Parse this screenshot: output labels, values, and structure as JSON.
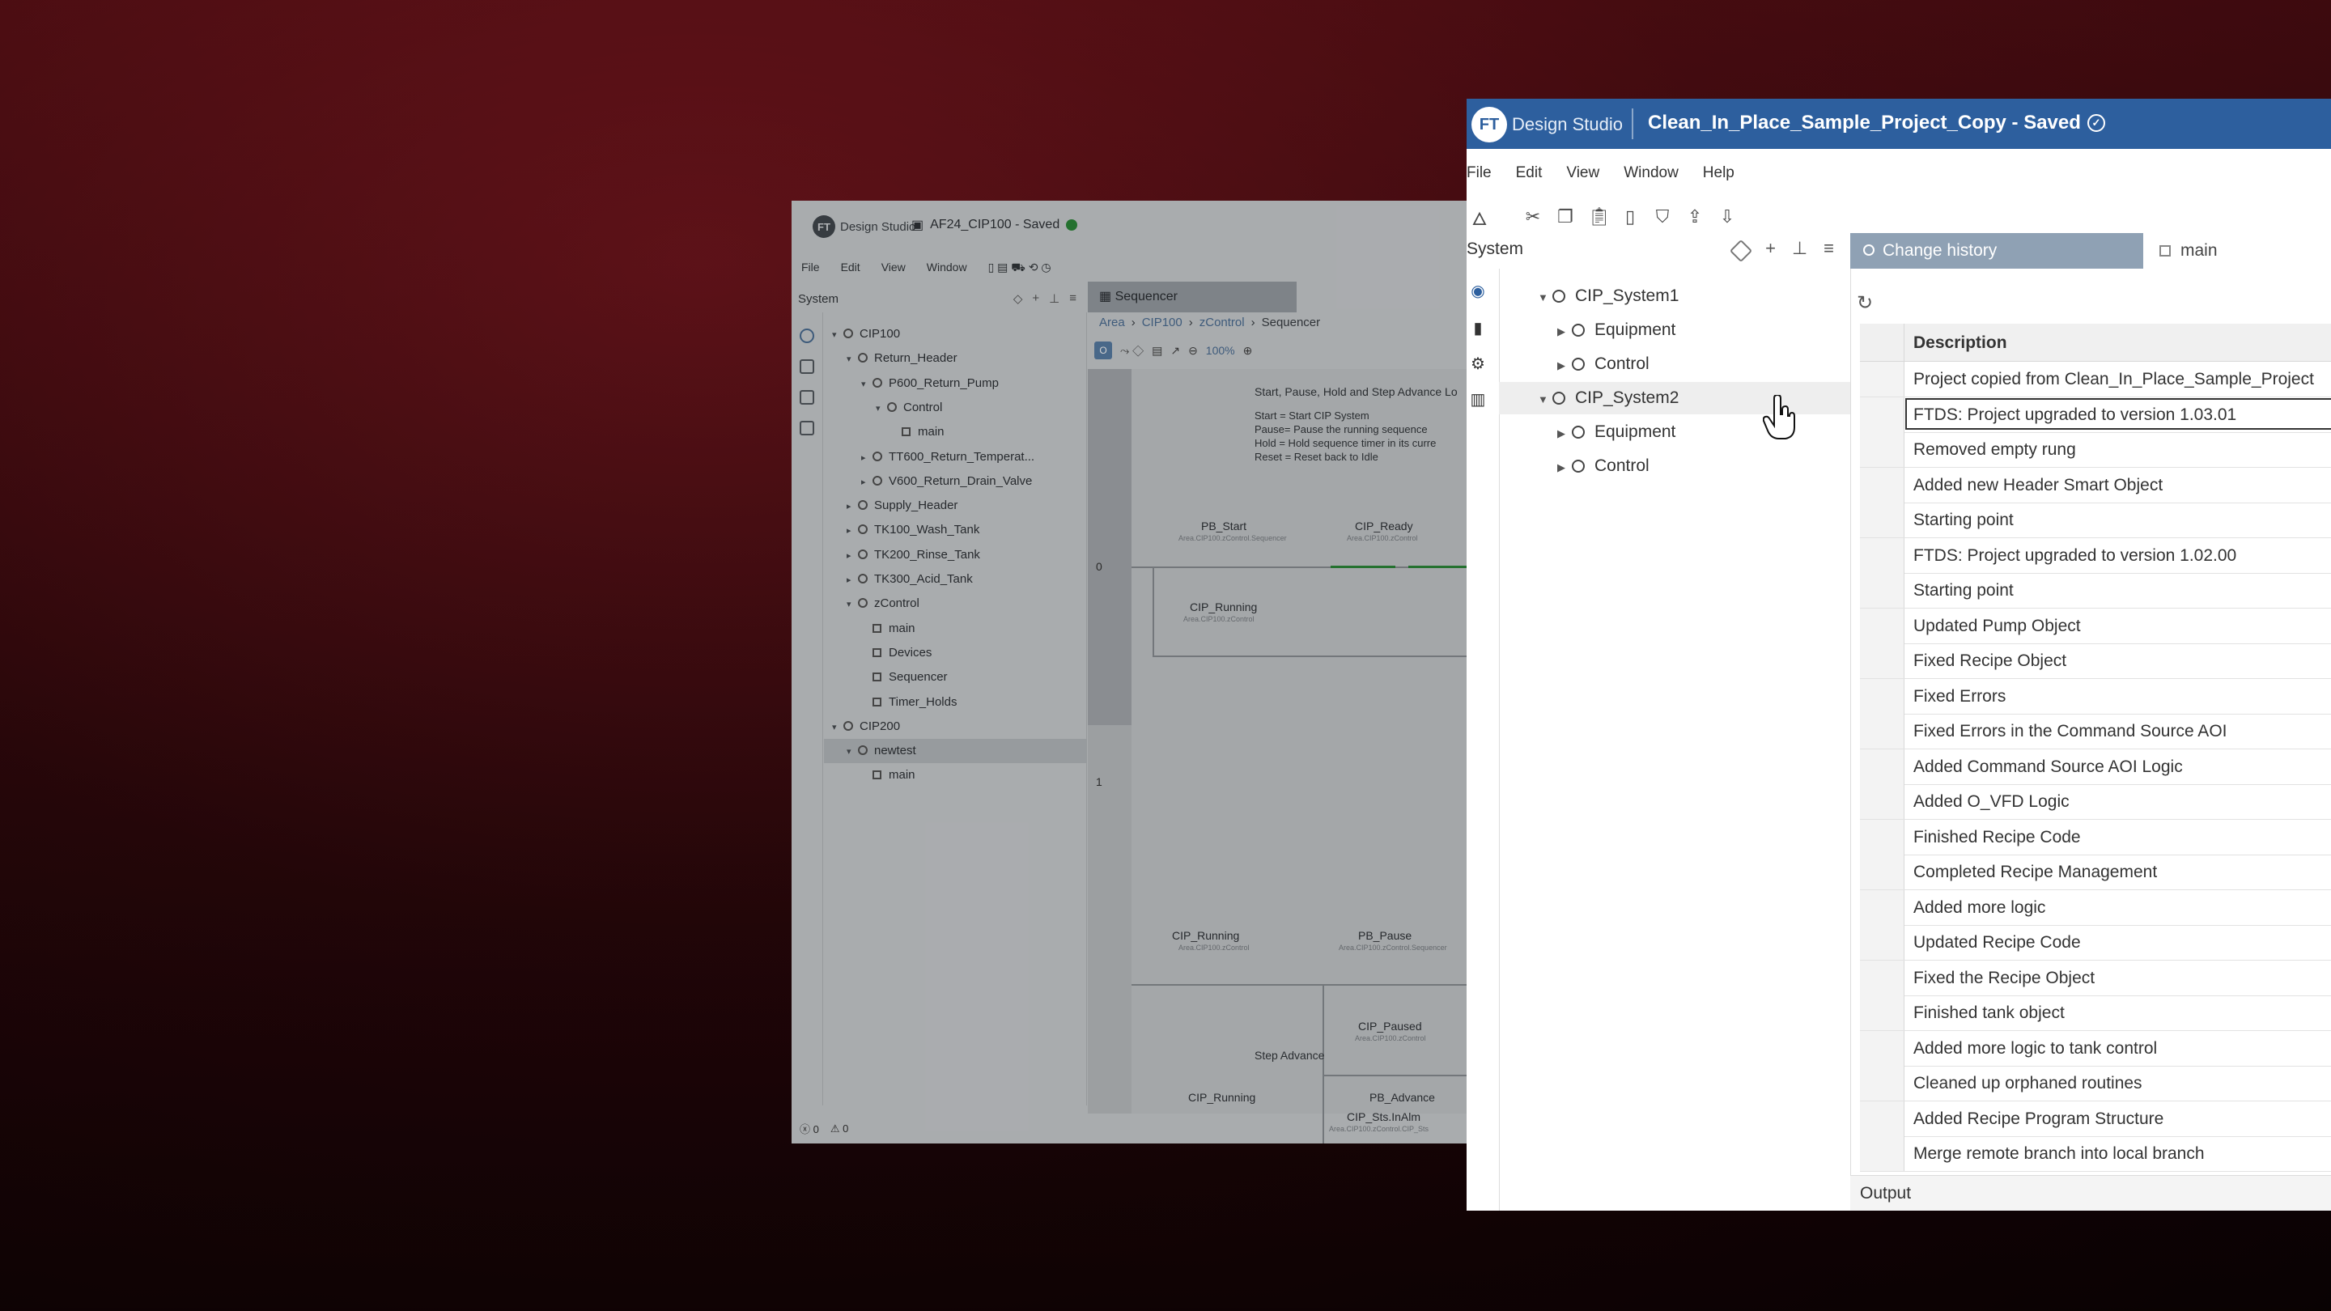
{
  "back_window": {
    "logo": "Design Studio",
    "project_title": "AF24_CIP100 - Saved",
    "menu": [
      "File",
      "Edit",
      "View",
      "Window"
    ],
    "panel_title": "System",
    "tree": [
      {
        "label": "CIP100",
        "level": 1,
        "type": "node",
        "expanded": true
      },
      {
        "label": "Return_Header",
        "level": 2,
        "type": "node",
        "expanded": true
      },
      {
        "label": "P600_Return_Pump",
        "level": 3,
        "type": "obj",
        "expanded": true
      },
      {
        "label": "Control",
        "level": 4,
        "type": "ctrl",
        "expanded": true
      },
      {
        "label": "main",
        "level": 5,
        "type": "routine"
      },
      {
        "label": "TT600_Return_Temperat...",
        "level": 3,
        "type": "obj",
        "expanded": false
      },
      {
        "label": "V600_Return_Drain_Valve",
        "level": 3,
        "type": "obj",
        "expanded": false
      },
      {
        "label": "Supply_Header",
        "level": 2,
        "type": "node",
        "expanded": false
      },
      {
        "label": "TK100_Wash_Tank",
        "level": 2,
        "type": "node",
        "expanded": false
      },
      {
        "label": "TK200_Rinse_Tank",
        "level": 2,
        "type": "node",
        "expanded": false
      },
      {
        "label": "TK300_Acid_Tank",
        "level": 2,
        "type": "node",
        "expanded": false
      },
      {
        "label": "zControl",
        "level": 2,
        "type": "prog",
        "expanded": true
      },
      {
        "label": "main",
        "level": 3,
        "type": "routine"
      },
      {
        "label": "Devices",
        "level": 3,
        "type": "routine"
      },
      {
        "label": "Sequencer",
        "level": 3,
        "type": "routine"
      },
      {
        "label": "Timer_Holds",
        "level": 3,
        "type": "routine"
      },
      {
        "label": "CIP200",
        "level": 1,
        "type": "node",
        "expanded": true
      },
      {
        "label": "newtest",
        "level": 2,
        "type": "prog",
        "expanded": true,
        "selected": true
      },
      {
        "label": "main",
        "level": 3,
        "type": "routine"
      }
    ],
    "tab": "Sequencer",
    "breadcrumb": [
      "Area",
      "CIP100",
      "zControl",
      "Sequencer"
    ],
    "zoom": "100%",
    "rung0_comment": "Start, Pause, Hold and Step Advance Lo",
    "rung0_notes": [
      "Start = Start CIP System",
      "Pause= Pause the running sequence",
      "Hold = Hold sequence timer in its curre",
      "Reset = Reset back to Idle"
    ],
    "rung0_num": "0",
    "rung1_num": "1",
    "tags": {
      "pb_start": "PB_Start",
      "pb_start_sub": "Area.CIP100.zControl.Sequencer",
      "cip_ready": "CIP_Ready",
      "cip_ready_sub": "Area.CIP100.zControl",
      "cip_running_a": "CIP_Running",
      "cip_running_a_sub": "Area.CIP100.zControl",
      "cip_running_b": "CIP_Running",
      "cip_running_b_sub": "Area.CIP100.zControl",
      "pb_pause": "PB_Pause",
      "pb_pause_sub": "Area.CIP100.zControl.Sequencer",
      "cip_paused": "CIP_Paused",
      "cip_paused_sub": "Area.CIP100.zControl",
      "cip_sts": "CIP_Sts.InAlm",
      "cip_sts_sub": "Area.CIP100.zControl.CIP_Sts",
      "step_advance": "Step Advance",
      "cip_running_c": "CIP_Running",
      "pb_advance": "PB_Advance"
    },
    "status_errors": "0",
    "status_warnings": "0"
  },
  "front_window": {
    "logo_text": "Design Studio",
    "project_title": "Clean_In_Place_Sample_Project_Copy - Saved",
    "menu": [
      "File",
      "Edit",
      "View",
      "Window",
      "Help"
    ],
    "panel_title": "System",
    "tree": [
      {
        "label": "CIP_System1",
        "level": 1,
        "expanded": true
      },
      {
        "label": "Equipment",
        "level": 2,
        "expanded": false
      },
      {
        "label": "Control",
        "level": 2,
        "expanded": false
      },
      {
        "label": "CIP_System2",
        "level": 1,
        "expanded": true,
        "selected": true
      },
      {
        "label": "Equipment",
        "level": 2,
        "expanded": false
      },
      {
        "label": "Control",
        "level": 2,
        "expanded": false
      }
    ],
    "tab_active": "Change history",
    "tab_other": "main",
    "table_header": "Description",
    "history": [
      "Project copied from Clean_In_Place_Sample_Project",
      "FTDS: Project upgraded to version 1.03.01",
      "Removed empty rung",
      "Added new Header Smart Object",
      "Starting point",
      "FTDS: Project upgraded to version 1.02.00",
      "Starting point",
      "Updated Pump Object",
      "Fixed Recipe Object",
      "Fixed Errors",
      "Fixed Errors in the Command Source AOI",
      "Added Command Source AOI Logic",
      "Added O_VFD Logic",
      "Finished Recipe Code",
      "Completed Recipe Management",
      "Added more logic",
      "Updated Recipe Code",
      "Fixed the Recipe Object",
      "Finished tank object",
      "Added more logic to tank control",
      "Cleaned up orphaned routines",
      "Added Recipe Program Structure",
      "Merge remote branch into local branch"
    ],
    "focused_row": 1,
    "output_label": "Output"
  }
}
